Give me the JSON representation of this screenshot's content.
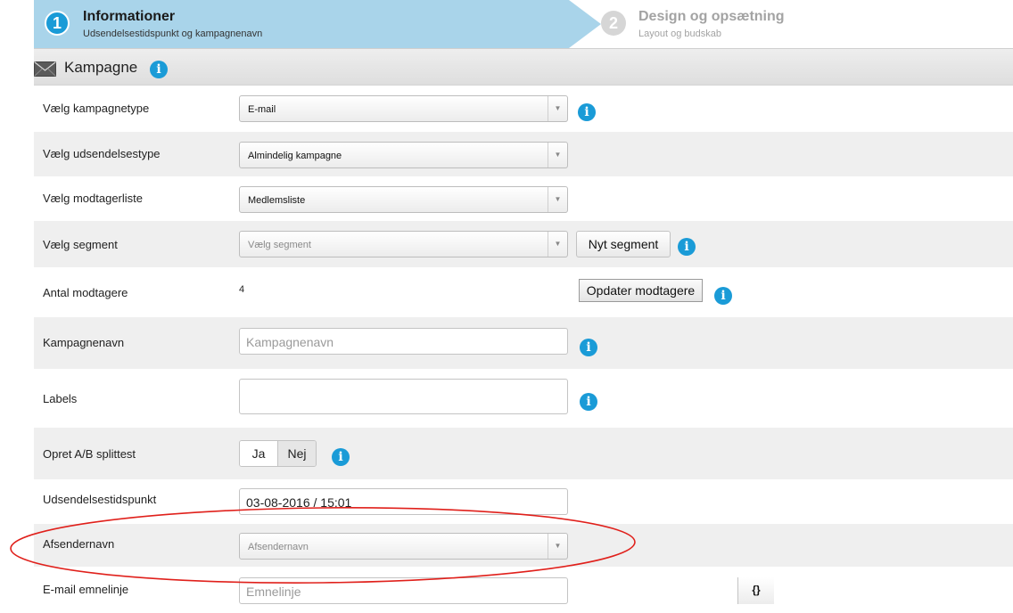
{
  "wizard": {
    "step1": {
      "number": "1",
      "title": "Informationer",
      "subtitle": "Udsendelsestidspunkt og kampagnenavn"
    },
    "step2": {
      "number": "2",
      "title": "Design og opsætning",
      "subtitle": "Layout og budskab"
    }
  },
  "section": {
    "title": "Kampagne",
    "icon": "envelope-icon"
  },
  "info_glyph": "i",
  "fields": {
    "campaign_type": {
      "label": "Vælg kampagnetype",
      "value": "E-mail"
    },
    "send_type": {
      "label": "Vælg udsendelsestype",
      "value": "Almindelig kampagne"
    },
    "recipient_list": {
      "label": "Vælg modtagerliste",
      "value": "Medlemsliste"
    },
    "segment": {
      "label": "Vælg segment",
      "placeholder": "Vælg segment",
      "button": "Nyt segment"
    },
    "recipient_count": {
      "label": "Antal modtagere",
      "value": "4",
      "button": "Opdater modtagere"
    },
    "campaign_name": {
      "label": "Kampagnenavn",
      "placeholder": "Kampagnenavn"
    },
    "labels": {
      "label": "Labels"
    },
    "ab_test": {
      "label": "Opret A/B splittest",
      "yes": "Ja",
      "no": "Nej",
      "selected": "Nej"
    },
    "send_time": {
      "label": "Udsendelsestidspunkt",
      "value": "03-08-2016 / 15:01"
    },
    "sender_name": {
      "label": "Afsendernavn",
      "placeholder": "Afsendernavn"
    },
    "subject": {
      "label": "E-mail emnelinje",
      "placeholder": "Emnelinje",
      "button": "{}"
    }
  },
  "colors": {
    "accent": "#1a9bd7",
    "active_step": "#a9d4ea",
    "annotation": "#e0201b"
  }
}
